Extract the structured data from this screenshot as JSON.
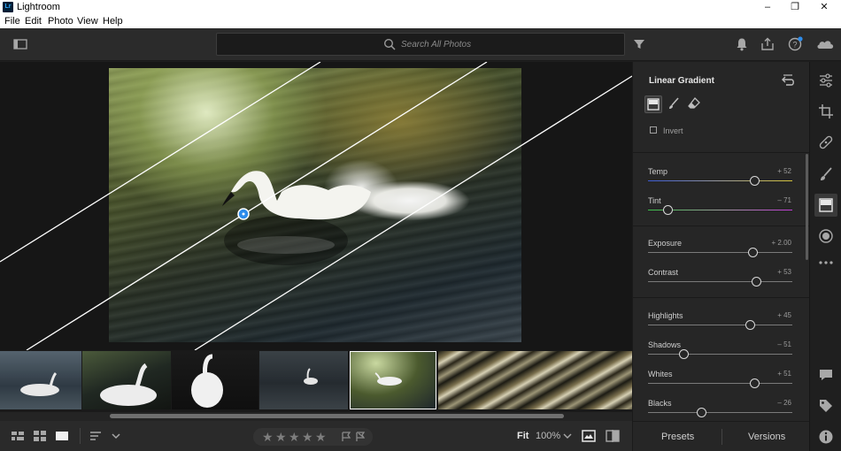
{
  "window": {
    "app_icon_text": "Lr",
    "title": "Lightroom",
    "minimize": "–",
    "maximize": "❐",
    "close": "✕"
  },
  "menu": {
    "items": [
      "File",
      "Edit",
      "Photo",
      "View",
      "Help"
    ]
  },
  "search": {
    "placeholder": "Search All Photos"
  },
  "panel": {
    "title": "Linear Gradient",
    "invert_label": "Invert",
    "sliders": [
      {
        "label": "Temp",
        "value": "+ 52",
        "position": 0.74
      },
      {
        "label": "Tint",
        "value": "– 71",
        "position": 0.14
      },
      {
        "label": "Exposure",
        "value": "+ 2.00",
        "position": 0.73
      },
      {
        "label": "Contrast",
        "value": "+ 53",
        "position": 0.75
      },
      {
        "label": "Highlights",
        "value": "+ 45",
        "position": 0.71
      },
      {
        "label": "Shadows",
        "value": "– 51",
        "position": 0.25
      },
      {
        "label": "Whites",
        "value": "+ 51",
        "position": 0.74
      },
      {
        "label": "Blacks",
        "value": "– 26",
        "position": 0.37
      }
    ]
  },
  "bottom": {
    "fit_label": "Fit",
    "zoom_label": "100%",
    "stars": [
      "★",
      "★",
      "★",
      "★",
      "★"
    ]
  },
  "presets_bar": {
    "presets": "Presets",
    "versions": "Versions"
  },
  "colors": {
    "accent": "#2d8ceb",
    "temp_left": "#3b5bd6",
    "temp_right": "#d6c43b",
    "tint_left": "#3bbf4a",
    "tint_right": "#c03bd6"
  }
}
